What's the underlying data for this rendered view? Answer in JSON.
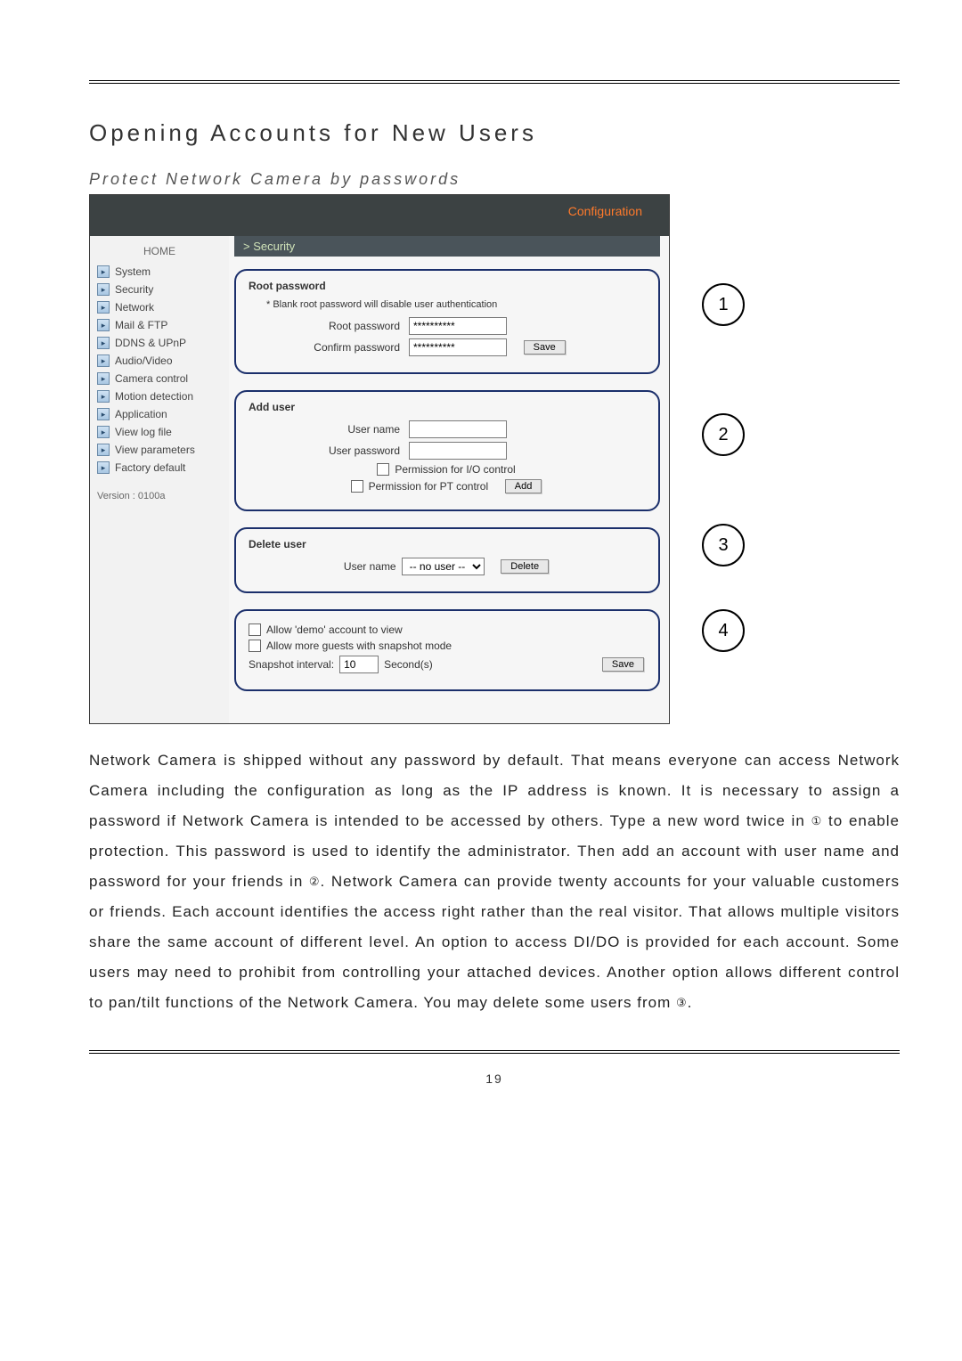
{
  "title": "Opening Accounts for New Users",
  "subtitle": "Protect Network Camera by passwords",
  "screenshot": {
    "topbar": "Configuration",
    "sidebar": {
      "home": "HOME",
      "items": [
        "System",
        "Security",
        "Network",
        "Mail & FTP",
        "DDNS & UPnP",
        "Audio/Video",
        "Camera control",
        "Motion detection",
        "Application",
        "View log file",
        "View parameters",
        "Factory default"
      ],
      "version": "Version : 0100a"
    },
    "breadcrumb": "> Security",
    "panel1": {
      "title": "Root password",
      "note": "* Blank root password will disable user authentication",
      "root_label": "Root password",
      "confirm_label": "Confirm password",
      "root_value": "**********",
      "confirm_value": "**********",
      "save": "Save"
    },
    "panel2": {
      "title": "Add user",
      "user_label": "User name",
      "pass_label": "User password",
      "perm_io": "Permission for I/O control",
      "perm_pt": "Permission for PT control",
      "add": "Add"
    },
    "panel3": {
      "title": "Delete user",
      "user_label": "User name",
      "sel_value": "-- no user --",
      "delete": "Delete"
    },
    "panel4": {
      "demo": "Allow 'demo' account to view",
      "guests": "Allow more guests with snapshot mode",
      "snap_label": "Snapshot interval:",
      "snap_value": "10",
      "snap_unit": "Second(s)",
      "save": "Save"
    }
  },
  "markers": {
    "m1": "1",
    "m2": "2",
    "m3": "3",
    "m4": "4"
  },
  "body": {
    "p1a": "Network Camera is shipped without any password by default. That means everyone can access Network Camera including the configuration as long as the IP address is known. It is necessary to assign a password if Network Camera is intended to be accessed by others. Type a new word twice in ",
    "c1": "①",
    "p1b": " to enable protection. This password is used to identify the administrator. Then add an account with user name and password for your friends in ",
    "c2": "②",
    "p1c": ". Network Camera can provide twenty accounts for your valuable customers or friends. Each account identifies the access right rather than the real visitor. That allows multiple visitors share the same account of different level.  An option to access DI/DO is provided for each account. Some users may need to prohibit from controlling your attached devices. Another option allows different control to pan/tilt functions of the Network Camera. You may delete some users from ",
    "c3": "③",
    "p1d": "."
  },
  "page_no": "19"
}
